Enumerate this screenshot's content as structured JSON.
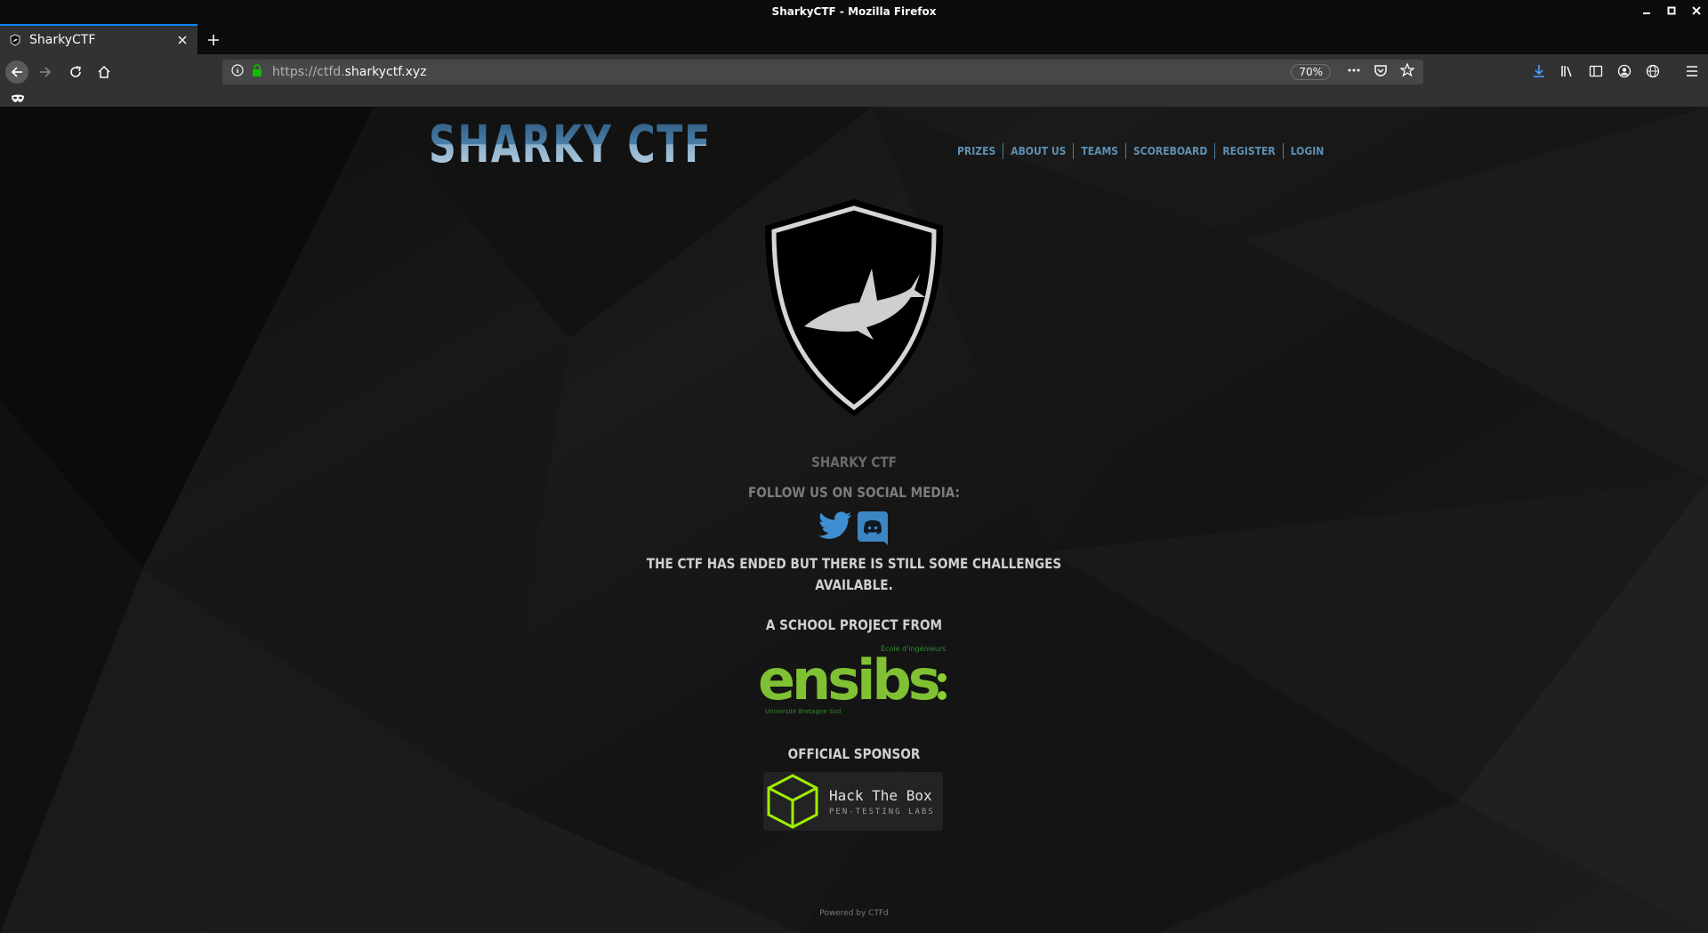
{
  "window": {
    "title": "SharkyCTF - Mozilla Firefox"
  },
  "tab": {
    "label": "SharkyCTF"
  },
  "urlbar": {
    "prefix": "https://ctfd.",
    "domain": "sharkyctf.xyz",
    "zoom": "70%"
  },
  "page": {
    "brand": "SHARKY CTF",
    "nav": [
      {
        "label": "PRIZES"
      },
      {
        "label": "ABOUT US"
      },
      {
        "label": "TEAMS"
      },
      {
        "label": "SCOREBOARD"
      },
      {
        "label": "REGISTER"
      },
      {
        "label": "LOGIN"
      }
    ],
    "site_name": "SHARKY CTF",
    "follow": "FOLLOW US ON SOCIAL MEDIA:",
    "message_line1": "THE CTF HAS ENDED BUT THERE IS STILL SOME CHALLENGES",
    "message_line2": "AVAILABLE.",
    "school_project": "A SCHOOL PROJECT FROM",
    "ensibs": {
      "name": "ensibs",
      "tagline": "École d'ingénieurs",
      "university": "Université Bretagne Sud"
    },
    "sponsor_heading": "OFFICIAL SPONSOR",
    "sponsor": {
      "name": "Hack The Box",
      "tagline": "PEN-TESTING LABS"
    },
    "powered_by": "Powered by CTFd"
  }
}
